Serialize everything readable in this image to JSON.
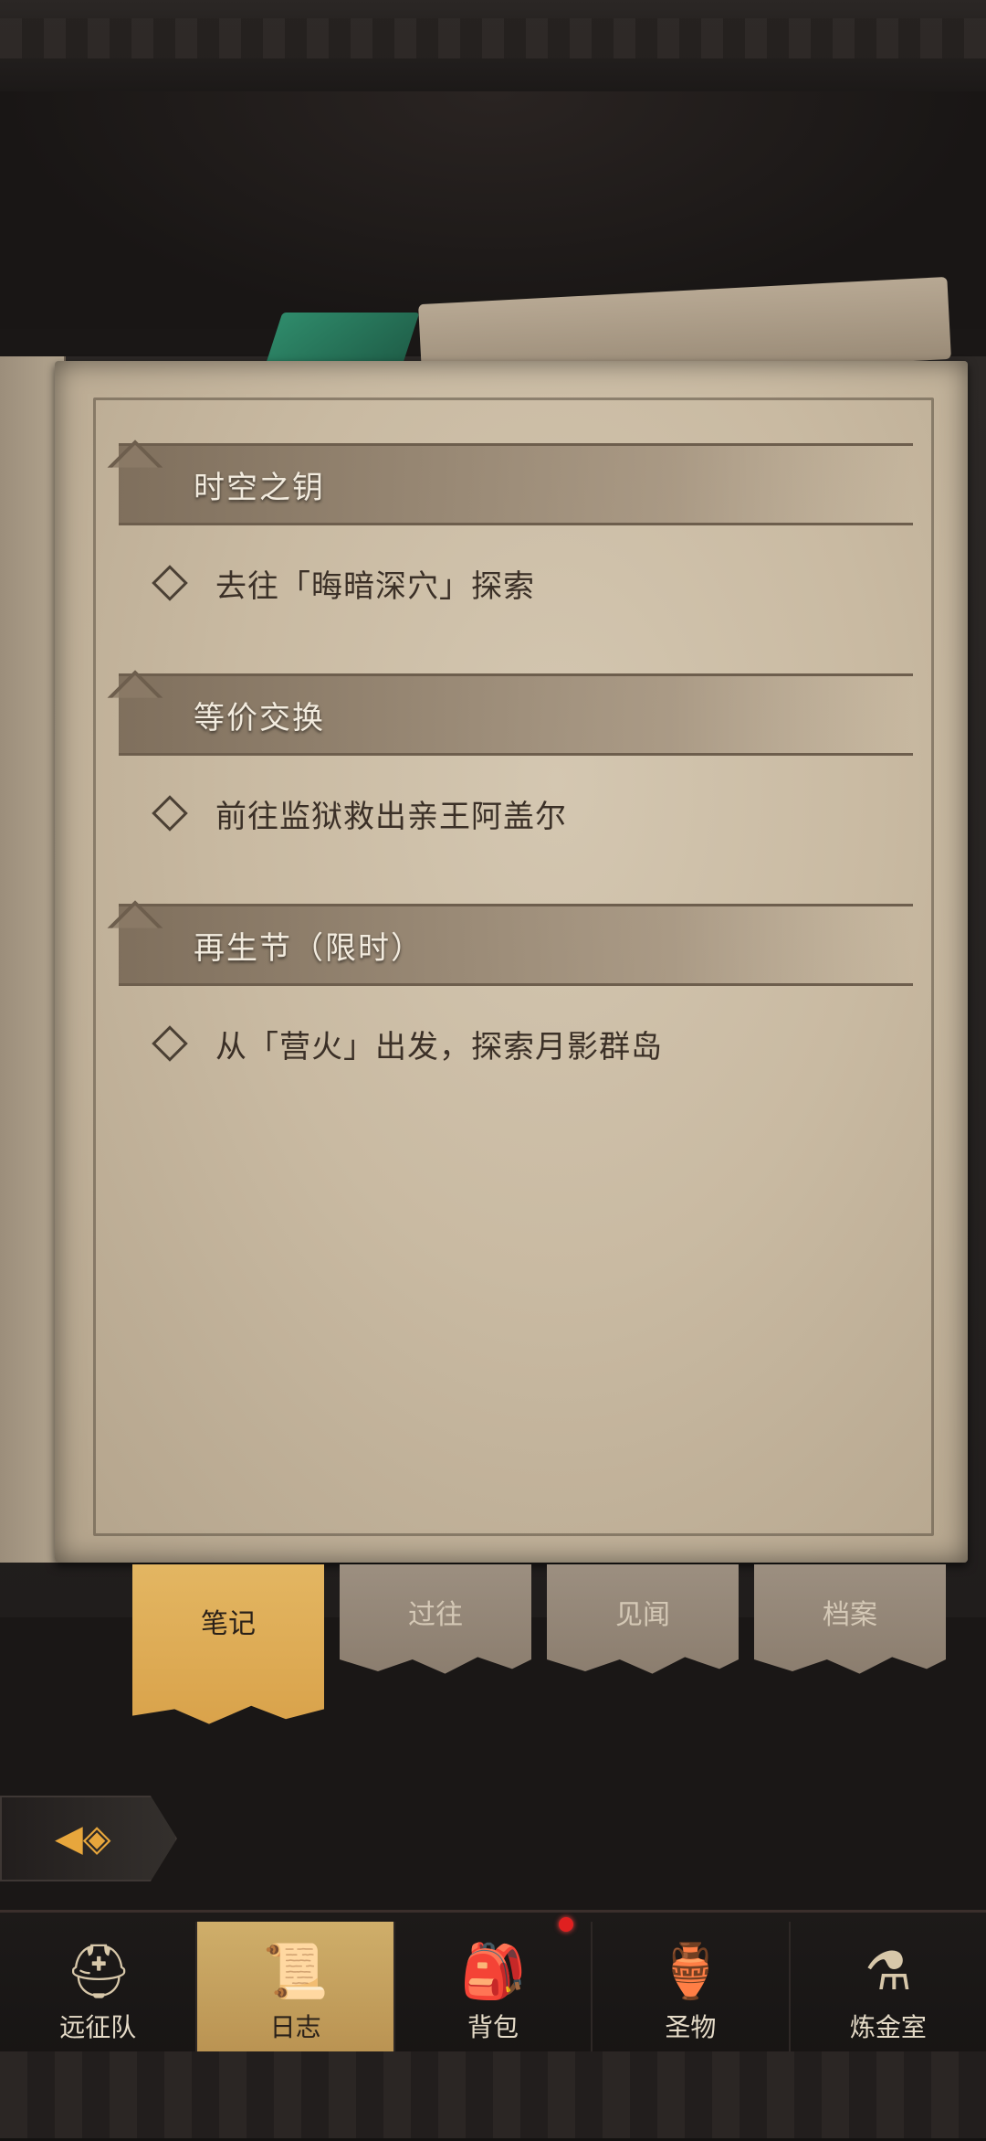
{
  "quests": [
    {
      "title": "时空之钥",
      "task": "去往「晦暗深穴」探索"
    },
    {
      "title": "等价交换",
      "task": "前往监狱救出亲王阿盖尔"
    },
    {
      "title": "再生节（限时）",
      "task": "从「营火」出发，探索月影群岛"
    }
  ],
  "tabs": [
    {
      "label": "笔记",
      "active": true
    },
    {
      "label": "过往",
      "active": false
    },
    {
      "label": "见闻",
      "active": false
    },
    {
      "label": "档案",
      "active": false
    }
  ],
  "nav": [
    {
      "label": "远征队",
      "icon": "viking-helmet-icon"
    },
    {
      "label": "日志",
      "icon": "journal-icon",
      "active": true
    },
    {
      "label": "背包",
      "icon": "backpack-icon",
      "has_notification": true
    },
    {
      "label": "圣物",
      "icon": "relic-icon"
    },
    {
      "label": "炼金室",
      "icon": "alchemy-icon"
    }
  ],
  "colors": {
    "accent": "#d9a24a",
    "notification": "#e02020"
  }
}
